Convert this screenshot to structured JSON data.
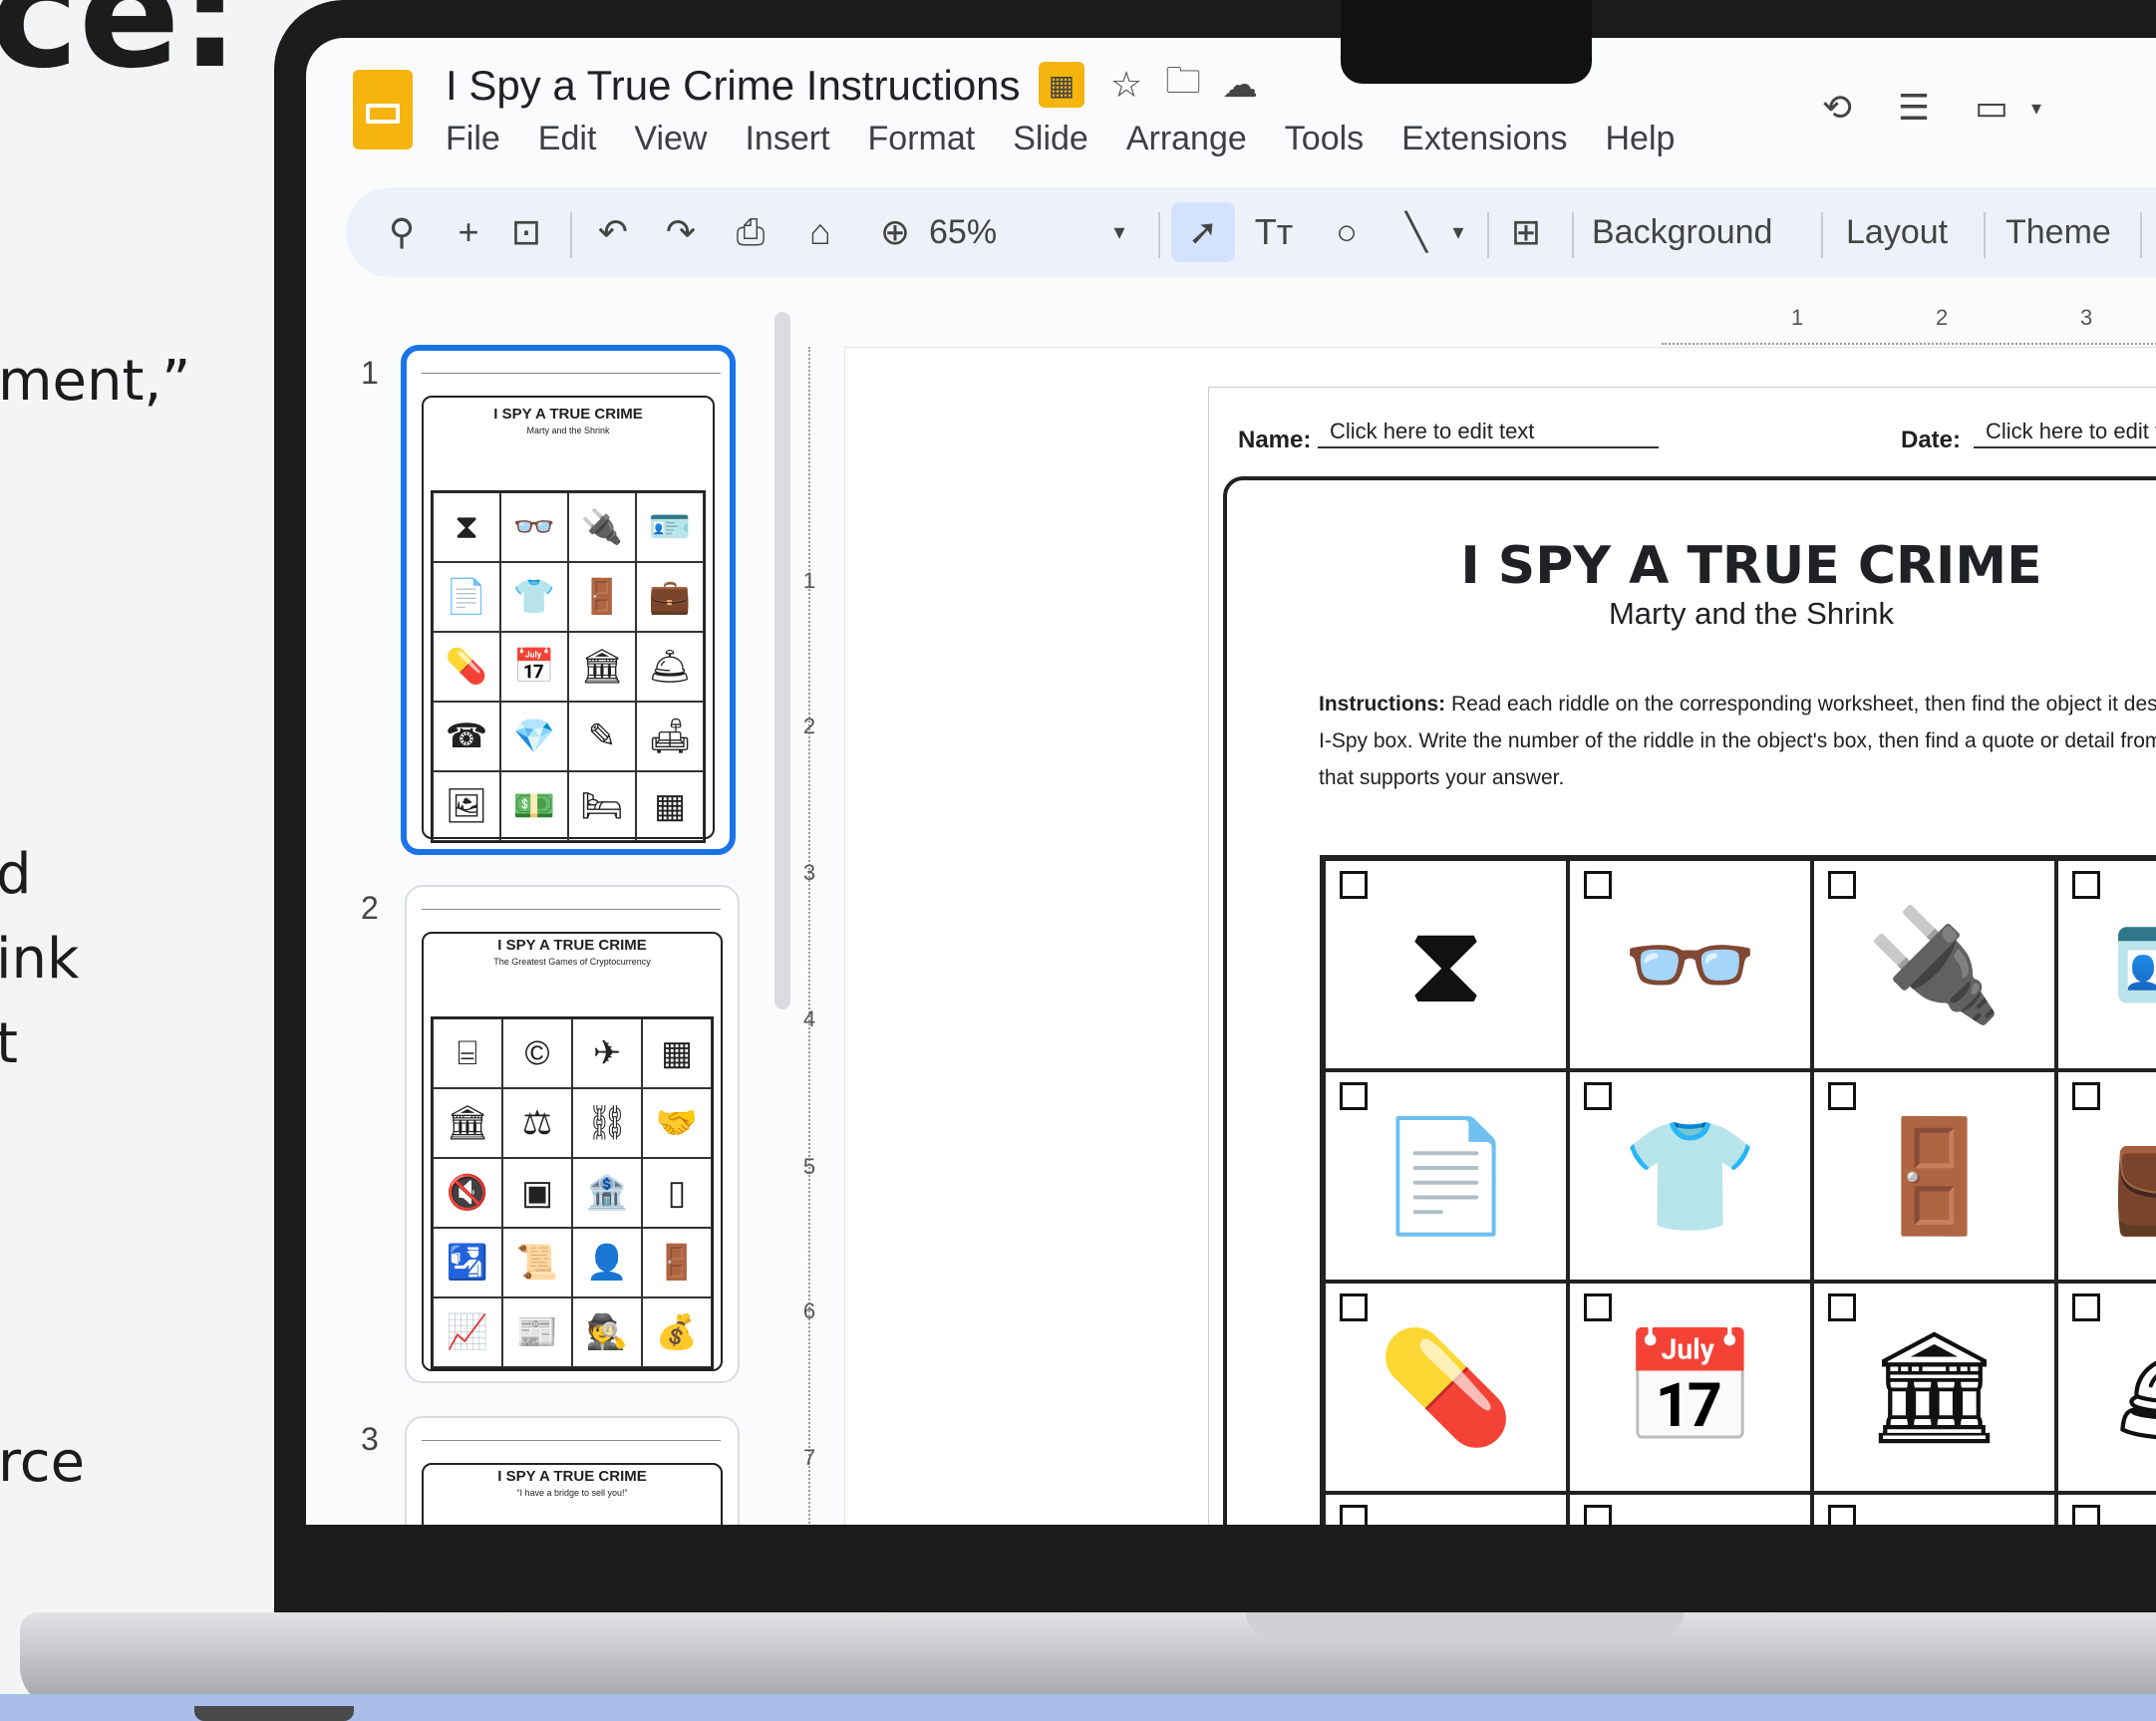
{
  "background_text": {
    "heading_fragment": "ce:",
    "lines": [
      "ment,”",
      "d",
      "ink",
      "t",
      "rce"
    ]
  },
  "app": {
    "doc_title": "I Spy a True Crime Instructions",
    "menu": [
      "File",
      "Edit",
      "View",
      "Insert",
      "Format",
      "Slide",
      "Arrange",
      "Tools",
      "Extensions",
      "Help"
    ],
    "title_icons": [
      "slides-icon",
      "star-icon",
      "folder-icon",
      "cloud-icon"
    ],
    "right_icons": [
      "history-icon",
      "comments-icon",
      "video-icon"
    ]
  },
  "toolbar": {
    "zoom": "65%",
    "background_label": "Background",
    "layout_label": "Layout",
    "theme_label": "Theme"
  },
  "ruler": {
    "horizontal": [
      "1",
      "2",
      "3"
    ],
    "vertical": [
      "1",
      "2",
      "3",
      "4",
      "5",
      "6",
      "7"
    ]
  },
  "thumbnails": [
    {
      "number": "1",
      "title": "I SPY A TRUE CRIME",
      "subtitle": "Marty and the Shrink"
    },
    {
      "number": "2",
      "title": "I SPY A TRUE CRIME",
      "subtitle": "The Greatest Games of Cryptocurrency"
    },
    {
      "number": "3",
      "title": "I SPY A TRUE CRIME",
      "subtitle": "“I have a bridge to sell you!”"
    }
  ],
  "worksheet": {
    "name_label": "Name:",
    "name_value": "Click here to edit text",
    "date_label": "Date:",
    "date_value": "Click here to edit t",
    "title": "I SPY A TRUE CRIME",
    "subtitle": "Marty and the Shrink",
    "instructions_label": "Instructions:",
    "instructions_text": "Read each riddle on the corresponding worksheet, then find the object it describe I-Spy box. Write the number of the riddle in the object's box, then find a quote or detail from the that supports your answer.",
    "cells": [
      "⧗",
      "👓",
      "🔌",
      "🪪",
      "📄",
      "👕",
      "🚪",
      "💼",
      "💊",
      "📅",
      "🏛",
      "🛎"
    ]
  }
}
